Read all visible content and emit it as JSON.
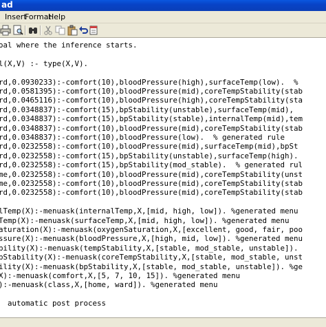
{
  "window": {
    "title": "ad"
  },
  "menu": [
    "Insert",
    "Format",
    "Help"
  ],
  "toolbar": {
    "icons": [
      "print-icon",
      "print-preview-icon",
      "find-icon",
      "cut-icon",
      "copy-icon",
      "paste-icon",
      "undo-icon",
      "insert-date-icon"
    ]
  },
  "editor": {
    "lines": [
      "oal where the inference starts.",
      "",
      "l(X,V) :- type(X,V).",
      "",
      "rd,0.0930233):-comfort(10),bloodPressure(high),surfaceTemp(low).  %",
      "rd,0.0581395):-comfort(10),bloodPressure(mid),coreTempStability(stab",
      "rd,0.0465116):-comfort(10),bloodPressure(high),coreTempStability(sta",
      "rd,0.0348837):-comfort(15),bpStability(unstable),surfaceTemp(mid),",
      "rd,0.0348837):-comfort(15),bpStability(stable),internalTemp(mid),tem",
      "rd,0.0348837):-comfort(10),bloodPressure(mid),coreTempStability(stab",
      "rd,0.0348837):-comfort(10),bloodPressure(low).  % generated rule",
      "rd,0.0232558):-comfort(10),bloodPressure(mid),surfaceTemp(mid),bpSt",
      "rd,0.0232558):-comfort(15),bpStability(unstable),surfaceTemp(high).",
      "rd,0.0232558):-comfort(15),bpStability(mod_stable).  % generated rul",
      "me,0.0232558):-comfort(10),bloodPressure(mid),coreTempStability(unst",
      "me,0.0232558):-comfort(10),bloodPressure(mid),coreTempStability(stab",
      "rd,0.0232558):-comfort(10),bloodPressure(mid),coreTempStability(stab",
      "",
      "lTemp(X):-menuask(internalTemp,X,[mid, high, low]). %generated menu",
      "Temp(X):-menuask(surfaceTemp,X,[mid, high, low]). %generated menu",
      "aturation(X):-menuask(oxygenSaturation,X,[excellent, good, fair, poo",
      "ssure(X):-menuask(bloodPressure,X,[high, mid, low]). %generated menu",
      "bility(X):-menuask(tempStability,X,[stable, mod_stable, unstable]).",
      "pStability(X):-menuask(coreTempStability,X,[stable, mod_stable, unst",
      "ility(X):-menuask(bpStability,X,[stable, mod_stable, unstable]). %ge",
      "X):-menuask(comfort,X,[5, 7, 10, 15]). %generated menu",
      "):-menuask(class,X,[home, ward]). %generated menu",
      "",
      "  automatic post process"
    ]
  }
}
